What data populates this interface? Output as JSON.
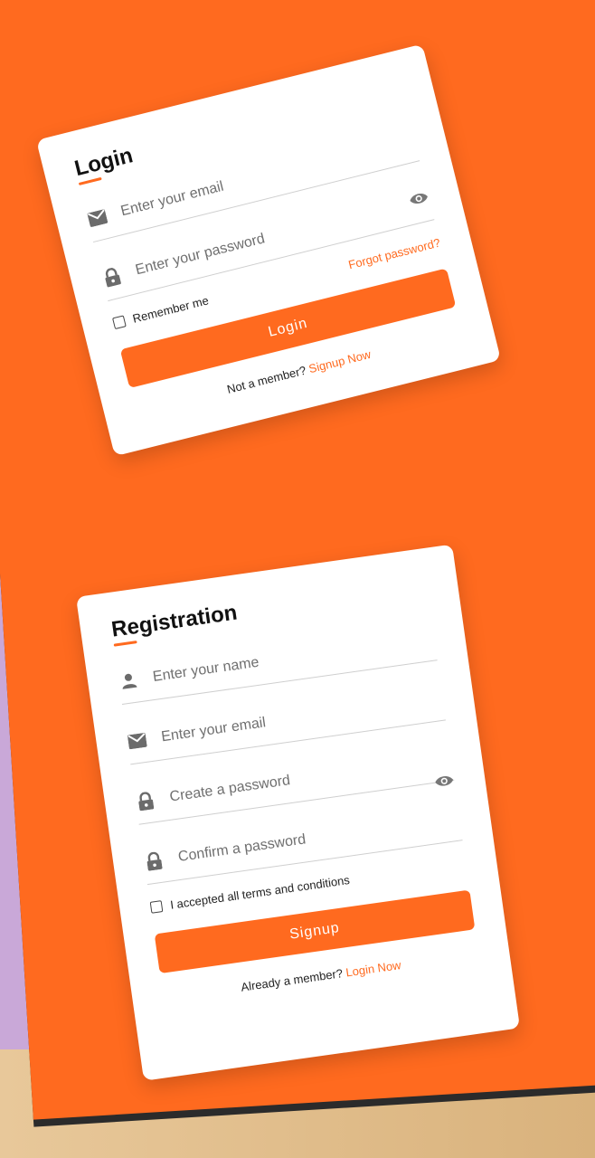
{
  "login": {
    "title": "Login",
    "email_placeholder": "Enter your email",
    "password_placeholder": "Enter your password",
    "remember_label": "Remember me",
    "forgot_label": "Forgot password?",
    "button_label": "Login",
    "footer_text": "Not a member?",
    "footer_link": "Signup Now"
  },
  "registration": {
    "title": "Registration",
    "name_placeholder": "Enter your name",
    "email_placeholder": "Enter your email",
    "password_placeholder": "Create a password",
    "confirm_placeholder": "Confirm a password",
    "terms_label": "I accepted all terms and conditions",
    "button_label": "Signup",
    "footer_text": "Already a member?",
    "footer_link": "Login Now"
  },
  "colors": {
    "accent": "#ff6a1f",
    "card": "#ffffff",
    "text": "#111111"
  },
  "icons": [
    "envelope-icon",
    "lock-icon",
    "eye-icon",
    "user-icon"
  ]
}
